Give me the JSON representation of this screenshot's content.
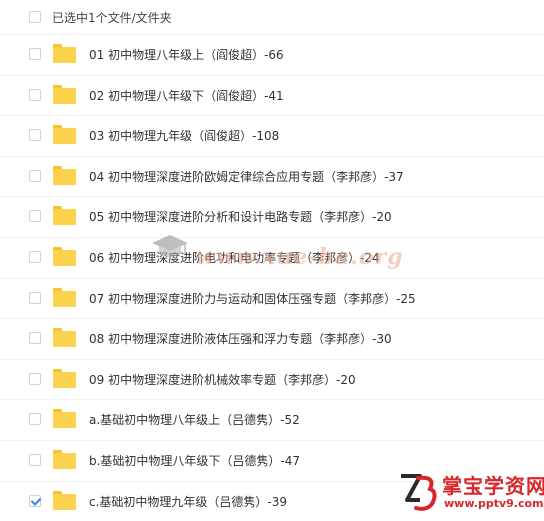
{
  "header": {
    "selection_text": "已选中1个文件/文件夹"
  },
  "rows": [
    {
      "name": "01 初中物理八年级上（阎俊超）-66",
      "checked": false
    },
    {
      "name": "02 初中物理八年级下（阎俊超）-41",
      "checked": false
    },
    {
      "name": "03 初中物理九年级（阎俊超）-108",
      "checked": false
    },
    {
      "name": "04 初中物理深度进阶欧姆定律综合应用专题（李邦彦）-37",
      "checked": false
    },
    {
      "name": "05 初中物理深度进阶分析和设计电路专题（李邦彦）-20",
      "checked": false
    },
    {
      "name": "06 初中物理深度进阶电功和电功率专题（李邦彦）-24",
      "checked": false
    },
    {
      "name": "07 初中物理深度进阶力与运动和固体压强专题（李邦彦）-25",
      "checked": false
    },
    {
      "name": "08 初中物理深度进阶液体压强和浮力专题（李邦彦）-30",
      "checked": false
    },
    {
      "name": "09 初中物理深度进阶机械效率专题（李邦彦）-20",
      "checked": false
    },
    {
      "name": "a.基础初中物理八年级上（吕德隽）-52",
      "checked": false
    },
    {
      "name": "b.基础初中物理八年级下（吕德隽）-47",
      "checked": false
    },
    {
      "name": "c.基础初中物理九年级（吕德隽）-39",
      "checked": true
    }
  ],
  "watermark": {
    "text": "www.xue-ba.org"
  },
  "brand": {
    "name": "掌宝学资网",
    "url": "www.pptv9.com"
  },
  "colors": {
    "folder": "#fbd24d",
    "check": "#2f86e8",
    "brand": "#d9262a"
  }
}
